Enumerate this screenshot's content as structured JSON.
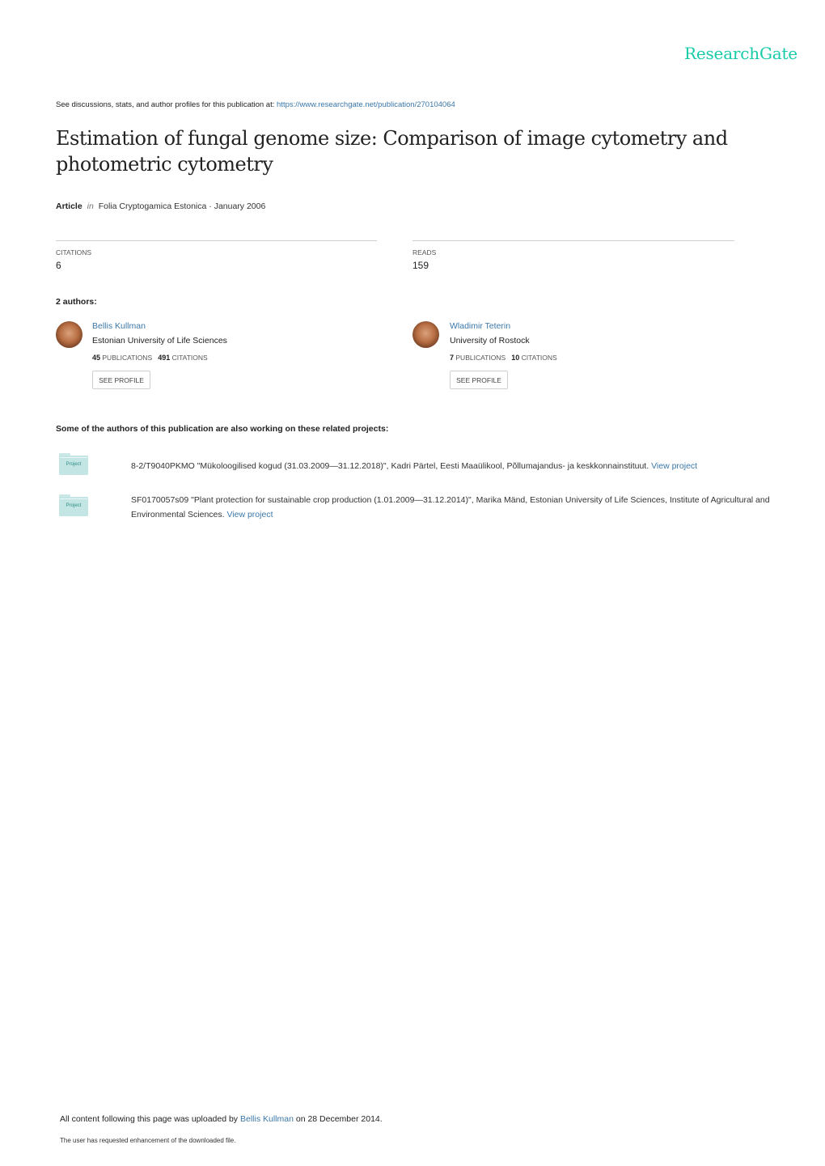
{
  "brand": {
    "logo_text": "ResearchGate",
    "accent_color": "#17cba8",
    "link_color": "#3b77a8"
  },
  "header": {
    "see_discussions_text": "See discussions, stats, and author profiles for this publication at: ",
    "publication_url": "https://www.researchgate.net/publication/270104064"
  },
  "publication": {
    "title": "Estimation of fungal genome size: Comparison of image cytometry and photometric cytometry",
    "type": "Article",
    "in_word": "in",
    "journal_and_date": "Folia Cryptogamica Estonica · January 2006"
  },
  "stats": {
    "citations_label": "CITATIONS",
    "citations_value": "6",
    "reads_label": "READS",
    "reads_value": "159"
  },
  "authors_heading": "2 authors:",
  "authors": [
    {
      "name": "Bellis Kullman",
      "institution": "Estonian University of Life Sciences",
      "publications_count": "45",
      "publications_label": "PUBLICATIONS",
      "citations_count": "491",
      "citations_label": "CITATIONS",
      "button_label": "SEE PROFILE"
    },
    {
      "name": "Wladimir Teterin",
      "institution": "University of Rostock",
      "publications_count": "7",
      "publications_label": "PUBLICATIONS",
      "citations_count": "10",
      "citations_label": "CITATIONS",
      "button_label": "SEE PROFILE"
    }
  ],
  "projects_heading": "Some of the authors of this publication are also working on these related projects:",
  "projects": [
    {
      "icon_label": "Project",
      "text": "8-2/T9040PKMO \"Mükoloogilised kogud (31.03.2009—31.12.2018)\", Kadri Pärtel, Eesti Maaülikool, Põllumajandus- ja keskkonnainstituut. ",
      "link_label": "View project"
    },
    {
      "icon_label": "Project",
      "text": "SF0170057s09 \"Plant protection for sustainable crop production (1.01.2009—31.12.2014)\", Marika Mänd, Estonian University of Life Sciences, Institute of Agricultural and Environmental Sciences. ",
      "link_label": "View project"
    }
  ],
  "footer": {
    "uploaded_prefix": "All content following this page was uploaded by ",
    "uploader": "Bellis Kullman",
    "uploaded_suffix": " on 28 December 2014.",
    "enhancement_note": "The user has requested enhancement of the downloaded file."
  }
}
